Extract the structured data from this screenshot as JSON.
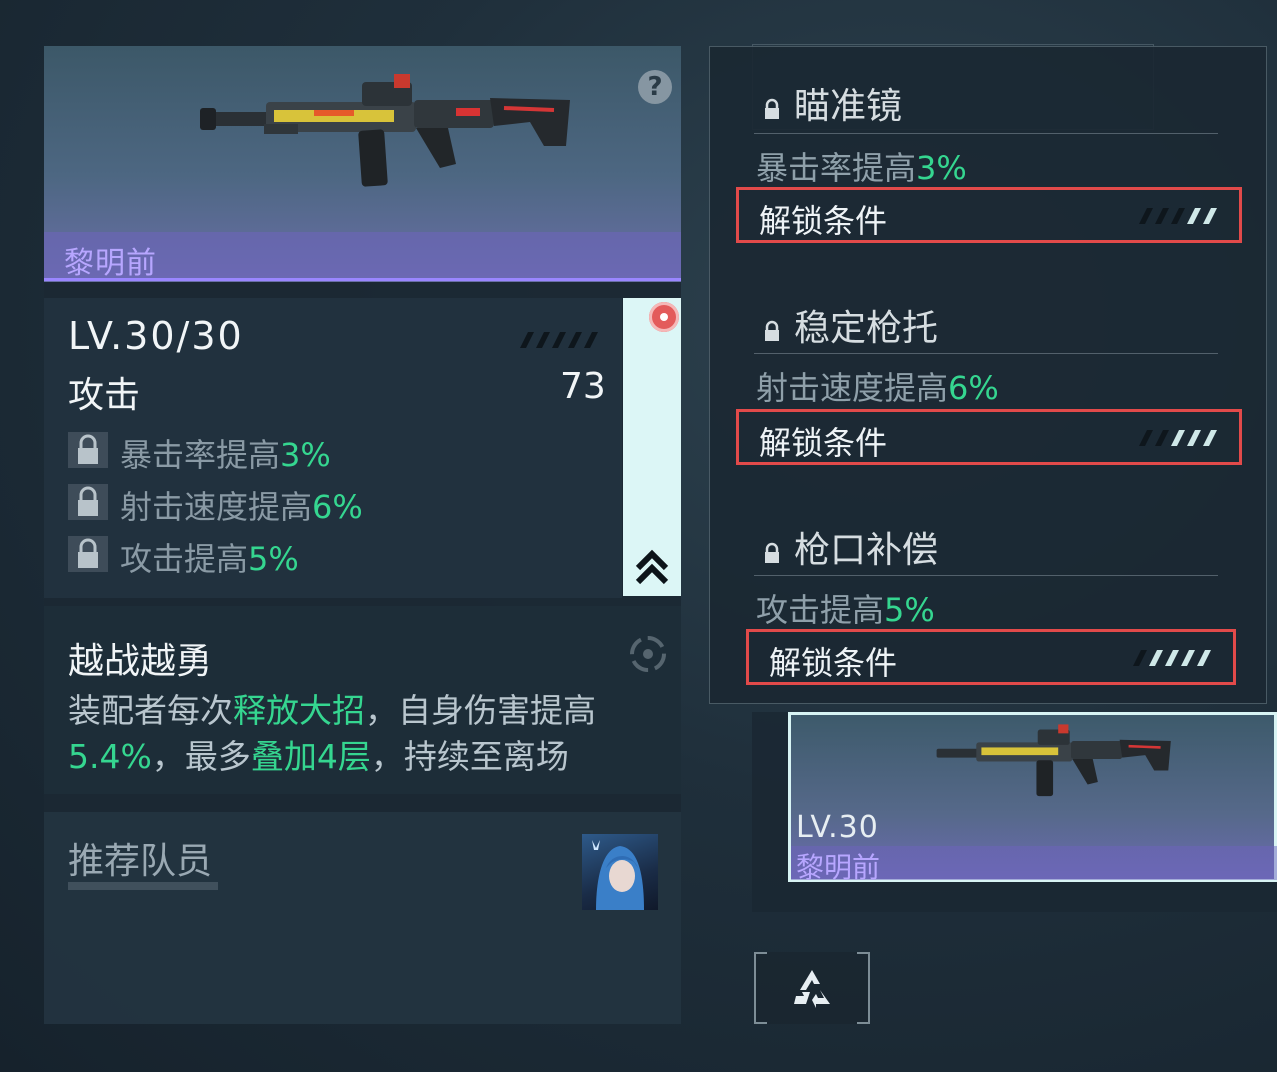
{
  "weapon": {
    "name": "黎明前",
    "level": "LV.30/30",
    "attack_label": "攻击",
    "attack_value": "73"
  },
  "bonuses": [
    {
      "text": "暴击率提高",
      "value": "3%"
    },
    {
      "text": "射击速度提高",
      "value": "6%"
    },
    {
      "text": "攻击提高",
      "value": "5%"
    }
  ],
  "skill": {
    "title": "越战越勇",
    "desc_1": "装配者每次",
    "desc_hl1": "释放大招",
    "desc_2": "，自身伤害提高",
    "desc_hl2": "5.4%",
    "desc_3": "，最多",
    "desc_hl3": "叠加4层",
    "desc_4": "，持续至离场"
  },
  "recommend": {
    "title": "推荐队员"
  },
  "attachments": [
    {
      "name": "瞄准镜",
      "effect_text": "暴击率提高",
      "effect_value": "3%",
      "unlock_label": "解锁条件"
    },
    {
      "name": "稳定枪托",
      "effect_text": "射击速度提高",
      "effect_value": "6%",
      "unlock_label": "解锁条件"
    },
    {
      "name": "枪口补偿",
      "effect_text": "攻击提高",
      "effect_value": "5%",
      "unlock_label": "解锁条件"
    }
  ],
  "card": {
    "level": "LV.30",
    "name": "黎明前"
  },
  "colors": {
    "highlight_green": "#35d690",
    "rarity_purple": "#b7a6ff",
    "unlock_border": "#e24a4a"
  }
}
